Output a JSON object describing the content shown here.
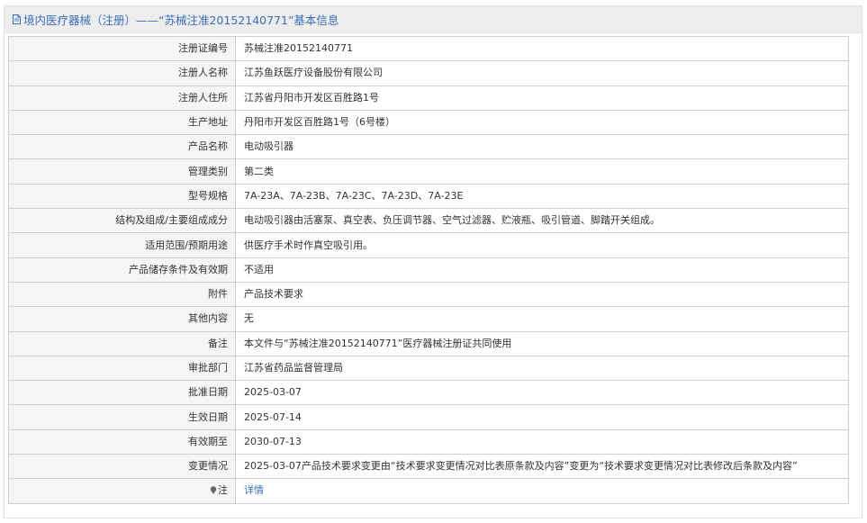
{
  "header": {
    "title": "境内医疗器械（注册）——“苏械注准20152140771”基本信息"
  },
  "rows": [
    {
      "label": "注册证编号",
      "value": "苏械注准20152140771"
    },
    {
      "label": "注册人名称",
      "value": "江苏鱼跃医疗设备股份有限公司"
    },
    {
      "label": "注册人住所",
      "value": "江苏省丹阳市开发区百胜路1号"
    },
    {
      "label": "生产地址",
      "value": "丹阳市开发区百胜路1号（6号楼）"
    },
    {
      "label": "产品名称",
      "value": "电动吸引器"
    },
    {
      "label": "管理类别",
      "value": "第二类"
    },
    {
      "label": "型号规格",
      "value": "7A-23A、7A-23B、7A-23C、7A-23D、7A-23E"
    },
    {
      "label": "结构及组成/主要组成成分",
      "value": "电动吸引器由活塞泵、真空表、负压调节器、空气过滤器、贮液瓶、吸引管道、脚踏开关组成。"
    },
    {
      "label": "适用范围/预期用途",
      "value": "供医疗手术时作真空吸引用。"
    },
    {
      "label": "产品储存条件及有效期",
      "value": "不适用"
    },
    {
      "label": "附件",
      "value": "产品技术要求"
    },
    {
      "label": "其他内容",
      "value": "无"
    },
    {
      "label": "备注",
      "value": "本文件与“苏械注准20152140771”医疗器械注册证共同使用"
    },
    {
      "label": "审批部门",
      "value": "江苏省药品监督管理局"
    },
    {
      "label": "批准日期",
      "value": "2025-03-07"
    },
    {
      "label": "生效日期",
      "value": "2025-07-14"
    },
    {
      "label": "有效期至",
      "value": "2030-07-13"
    },
    {
      "label": "变更情况",
      "value": "2025-03-07产品技术要求变更由“技术要求变更情况对比表原条款及内容”变更为“技术要求变更情况对比表修改后条款及内容”"
    }
  ],
  "note_row": {
    "label": "注",
    "link_text": "详情",
    "icon": "pin-icon"
  },
  "colors": {
    "title_text": "#3a6eb8",
    "link": "#3a6eb8",
    "label_bg": "#f5f5f5",
    "border": "#cfcfcf"
  }
}
